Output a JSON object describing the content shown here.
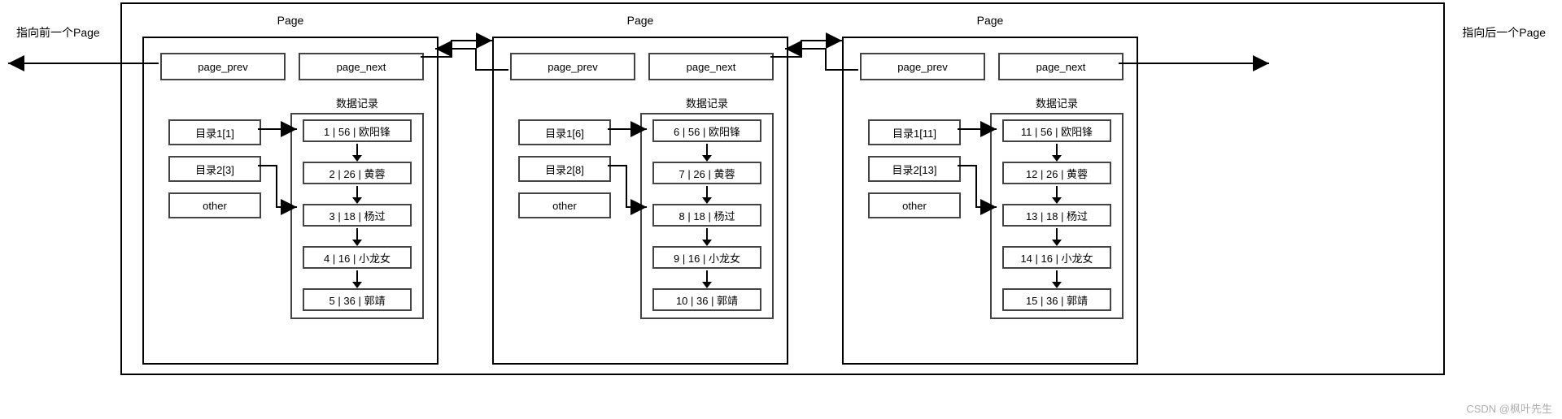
{
  "labels": {
    "page_title": "Page",
    "page_prev": "page_prev",
    "page_next": "page_next",
    "data_records": "数据记录",
    "other": "other",
    "prev_label": "指向前一个Page",
    "next_label": "指向后一个Page",
    "watermark": "CSDN @枫叶先生"
  },
  "pages": [
    {
      "directories": [
        "目录1[1]",
        "目录2[3]"
      ],
      "records": [
        "1 | 56 | 欧阳锋",
        "2 | 26 | 黄蓉",
        "3 | 18 | 杨过",
        "4 | 16 | 小龙女",
        "5 | 36 | 郭靖"
      ]
    },
    {
      "directories": [
        "目录1[6]",
        "目录2[8]"
      ],
      "records": [
        "6 | 56 | 欧阳锋",
        "7 | 26 | 黄蓉",
        "8 | 18 | 杨过",
        "9 | 16 | 小龙女",
        "10 | 36 | 郭靖"
      ]
    },
    {
      "directories": [
        "目录1[11]",
        "目录2[13]"
      ],
      "records": [
        "11 | 56 | 欧阳锋",
        "12 | 26 | 黄蓉",
        "13 | 18 | 杨过",
        "14 | 16 | 小龙女",
        "15 | 36 | 郭靖"
      ]
    }
  ]
}
